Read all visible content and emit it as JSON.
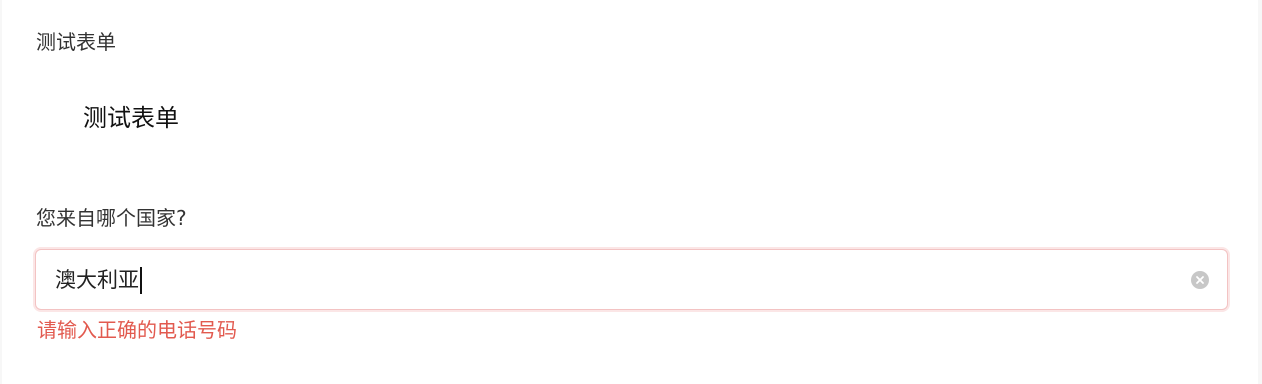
{
  "panel": {
    "title": "测试表单"
  },
  "form": {
    "title": "测试表单",
    "question": {
      "label": "您来自哪个国家?",
      "value": "澳大利亚",
      "error": "请输入正确的电话号码"
    }
  },
  "colors": {
    "error": "#e25a4f",
    "input_border": "#f3c3c3"
  }
}
